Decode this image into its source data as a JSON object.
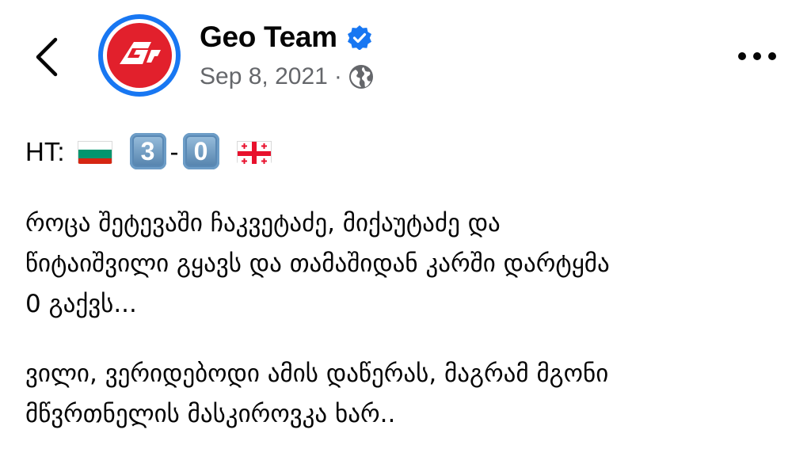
{
  "header": {
    "page_name": "Geo Team",
    "verified_icon": "verified-badge-icon",
    "date": "Sep 8, 2021",
    "separator": "·",
    "privacy_icon": "globe-icon",
    "back_icon": "chevron-left-icon",
    "more_icon": "more-dots-icon"
  },
  "post": {
    "score": {
      "label": "HT:",
      "home_flag": "bulgaria-flag",
      "home_score": "3",
      "dash": "-",
      "away_score": "0",
      "away_flag": "georgia-flag"
    },
    "paragraph1": [
      "როცა შეტევაში ჩაკვეტაძე, მიქაუტაძე და",
      "წიტაიშვილი გყავს და თამაშიდან კარში დარტყმა",
      "0 გაქვს..."
    ],
    "paragraph2": [
      "ვილი, ვერიდებოდი ამის დაწერას, მაგრამ მგონი",
      "მწვრთნელის მასკიროვკა ხარ.."
    ]
  },
  "colors": {
    "accent": "#1877f2",
    "brand_red": "#e2202c",
    "text": "#050505",
    "meta": "#65676b"
  }
}
